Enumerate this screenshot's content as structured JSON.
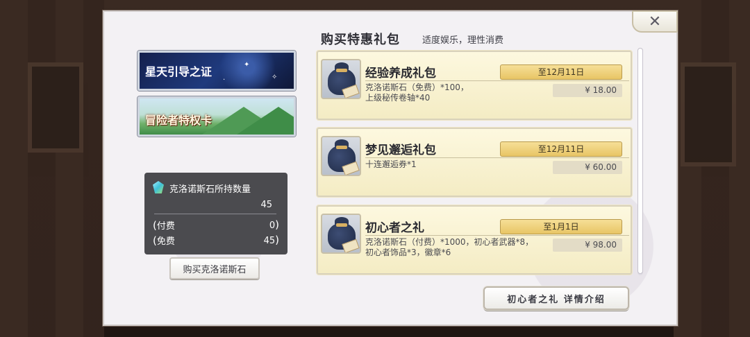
{
  "dialog": {
    "title": "购买特惠礼包",
    "subtitle": "适度娱乐，理性消费",
    "close_label": "✕"
  },
  "banners": [
    {
      "text": "星天引导之证",
      "icon": "star-banner"
    },
    {
      "text": "冒险者特权卡",
      "icon": "adventurer-banner"
    }
  ],
  "stone_panel": {
    "label": "克洛诺斯石所持数量",
    "total": "45",
    "paid_label": "付费",
    "paid_value": "0",
    "free_label": "免费",
    "free_value": "45",
    "paren_open": "(",
    "paren_close": ")",
    "gem_icon": "gem-icon"
  },
  "buy_stone_button": "购买克洛诺斯石",
  "packages": [
    {
      "name": "经验养成礼包",
      "date": "至12月11日",
      "desc_line1": "克洛诺斯石（免费）*100，",
      "desc_line2": "上级秘传卷轴*40",
      "price": "¥  18.00"
    },
    {
      "name": "梦见邂逅礼包",
      "date": "至12月11日",
      "desc_line1": "十连邂逅券*1",
      "desc_line2": "",
      "price": "¥  60.00"
    },
    {
      "name": "初心者之礼",
      "date": "至1月1日",
      "desc_line1": "克洛诺斯石（付费）*1000，初心者武器*8，",
      "desc_line2": "初心者饰品*3，徽章*6",
      "price": "¥  98.00"
    }
  ],
  "detail_button": "初心者之礼 详情介绍",
  "colors": {
    "date_badge": "#e8c565",
    "pack_bg": "#f4ecc4",
    "panel_dark": "#4b4b4f"
  }
}
